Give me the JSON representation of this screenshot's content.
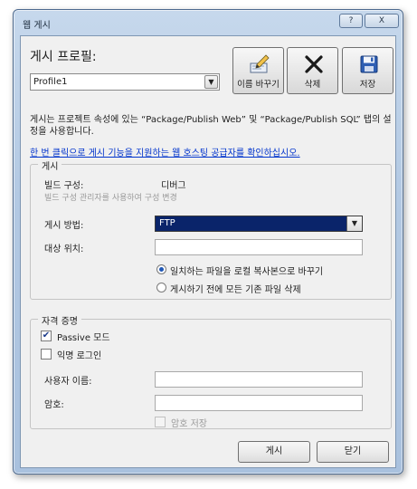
{
  "window": {
    "title": "웹 게시",
    "help_label": "?",
    "close_label": "X"
  },
  "profile": {
    "heading": "게시 프로필:",
    "selected": "Profile1",
    "rename_label": "이름 바꾸기",
    "delete_label": "삭제",
    "save_label": "저장"
  },
  "description": "게시는 프로젝트 속성에 있는 “Package/Publish Web” 및 “Package/Publish SQL” 탭의 설정을 사용합니다.",
  "hosting_link": "한 번 클릭으로 게시 기능을 지원하는 웹 호스팅 공급자를 확인하십시오.",
  "publish": {
    "legend": "게시",
    "build_config_label": "빌드 구성:",
    "build_config_value": "디버그",
    "build_config_hint": "빌드 구성 관리자를 사용하여 구성 변경",
    "method_label": "게시 방법:",
    "method_value": "FTP",
    "target_label": "대상 위치:",
    "target_value": "",
    "option_replace": "일치하는 파일을 로컬 복사본으로 바꾸기",
    "option_delete": "게시하기 전에 모든 기존 파일 삭제",
    "option_replace_selected": true
  },
  "credentials": {
    "legend": "자격 증명",
    "passive_label": "Passive 모드",
    "passive_checked": true,
    "anonymous_label": "익명 로그인",
    "anonymous_checked": false,
    "username_label": "사용자 이름:",
    "username_value": "",
    "password_label": "암호:",
    "password_value": "",
    "save_password_label": "암호 저장",
    "save_password_enabled": false
  },
  "footer": {
    "publish_label": "게시",
    "close_label": "닫기"
  }
}
